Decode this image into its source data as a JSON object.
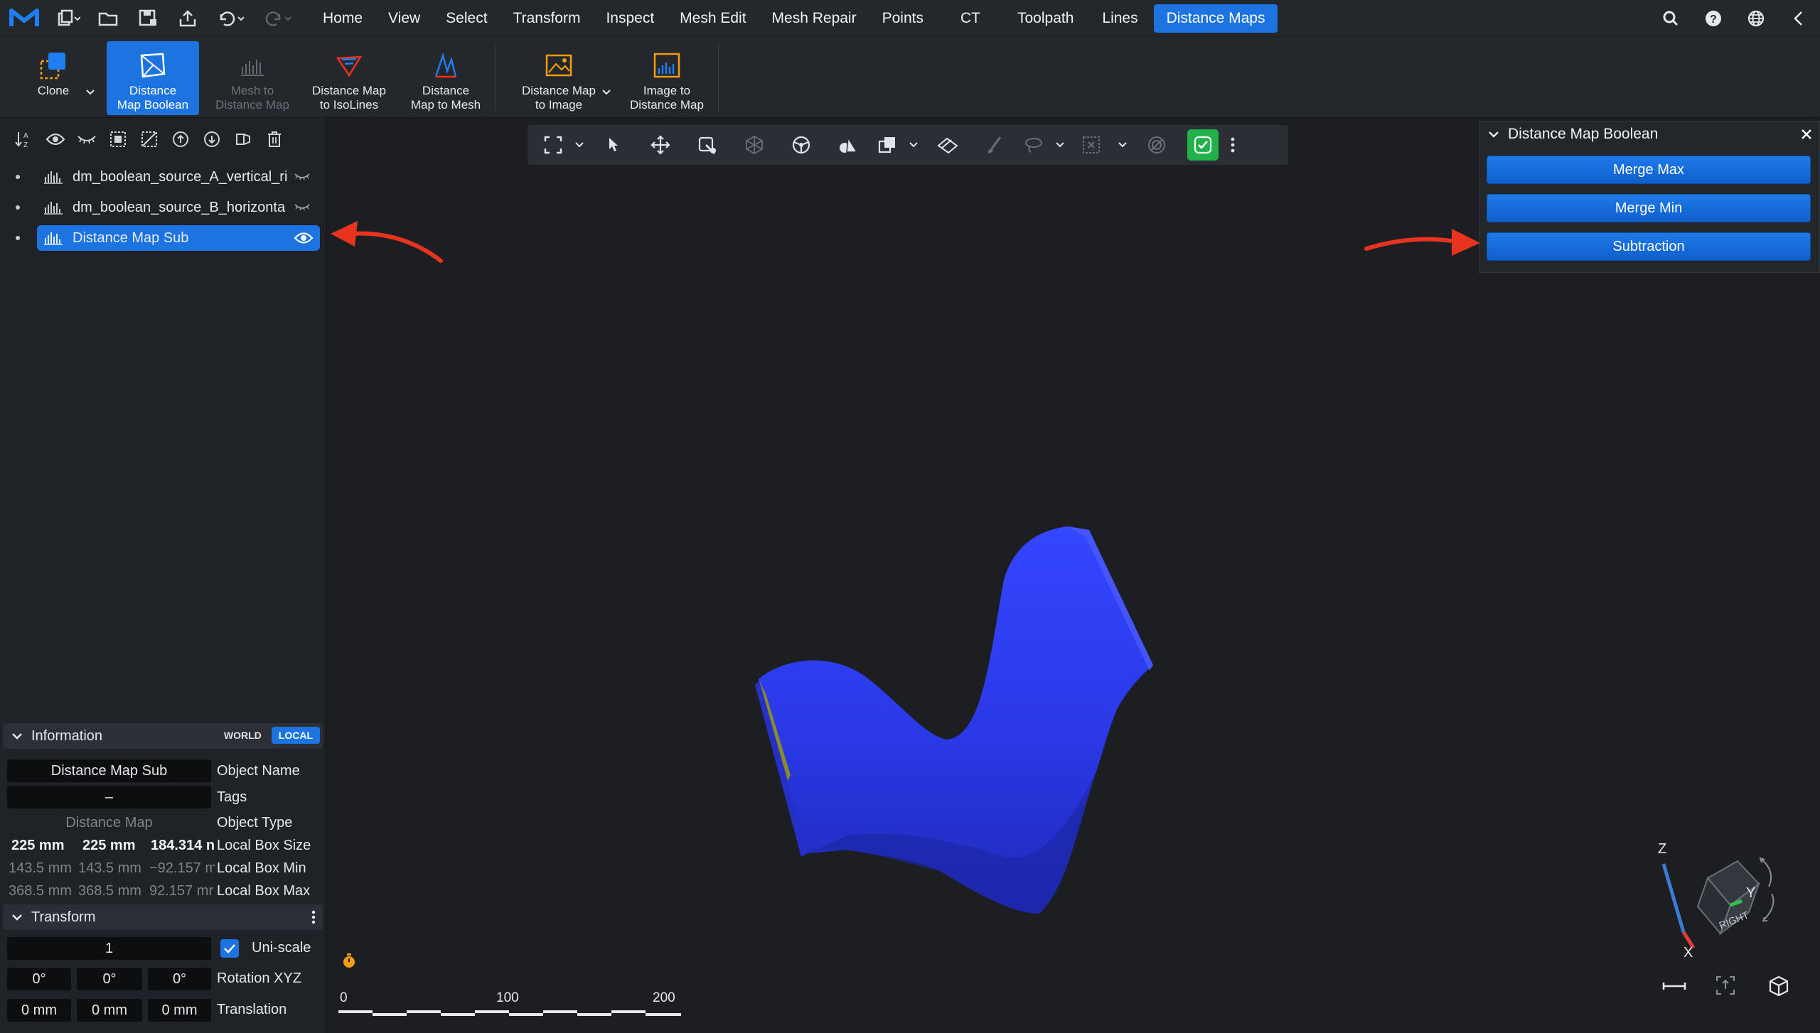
{
  "menubar": {
    "tabs": [
      "Home",
      "View",
      "Select",
      "Transform",
      "Inspect",
      "Mesh Edit",
      "Mesh Repair",
      "Points",
      "CT",
      "Toolpath",
      "Lines",
      "Distance Maps"
    ],
    "active_tab": "Distance Maps"
  },
  "ribbon": {
    "clone": "Clone",
    "dm_boolean": "Distance\nMap Boolean",
    "mesh_to_dm": "Mesh to\nDistance Map",
    "dm_to_isolines": "Distance Map\nto IsoLines",
    "dm_to_mesh": "Distance\nMap to Mesh",
    "dm_to_image": "Distance Map\nto Image",
    "image_to_dm": "Image to\nDistance Map"
  },
  "scene_tree": {
    "items": [
      {
        "label": "dm_boolean_source_A_vertical_ri",
        "selected": false
      },
      {
        "label": "dm_boolean_source_B_horizonta",
        "selected": false
      },
      {
        "label": "Distance Map Sub",
        "selected": true
      }
    ]
  },
  "information": {
    "title": "Information",
    "world": "WORLD",
    "local": "LOCAL",
    "object_name_value": "Distance Map Sub",
    "object_name_label": "Object Name",
    "tags_value": "–",
    "tags_label": "Tags",
    "object_type_value": "Distance Map",
    "object_type_label": "Object Type",
    "box_size": [
      "225 mm",
      "225 mm",
      "184.314 n"
    ],
    "box_size_label": "Local Box Size",
    "box_min": [
      "143.5 mm",
      "143.5 mm",
      "−92.157 m"
    ],
    "box_min_label": "Local Box Min",
    "box_max": [
      "368.5 mm",
      "368.5 mm",
      "92.157 mr"
    ],
    "box_max_label": "Local Box Max"
  },
  "transform": {
    "title": "Transform",
    "scale_value": "1",
    "uniscale_label": "Uni-scale",
    "rotation": [
      "0°",
      "0°",
      "0°"
    ],
    "rotation_label": "Rotation XYZ",
    "translation": [
      "0 mm",
      "0 mm",
      "0 mm"
    ],
    "translation_label": "Translation"
  },
  "dm_boolean_panel": {
    "title": "Distance Map Boolean",
    "buttons": [
      "Merge Max",
      "Merge Min",
      "Subtraction"
    ]
  },
  "scale_bar": {
    "ticks": [
      "0",
      "100",
      "200"
    ]
  },
  "axes_gizmo": {
    "z": "Z",
    "y": "Y",
    "x": "X",
    "face": "RIGHT"
  },
  "colors": {
    "accent": "#1d74e0",
    "mesh": "#2f3cf0",
    "ok_green": "#21b14a",
    "arrow": "#e8341f"
  }
}
